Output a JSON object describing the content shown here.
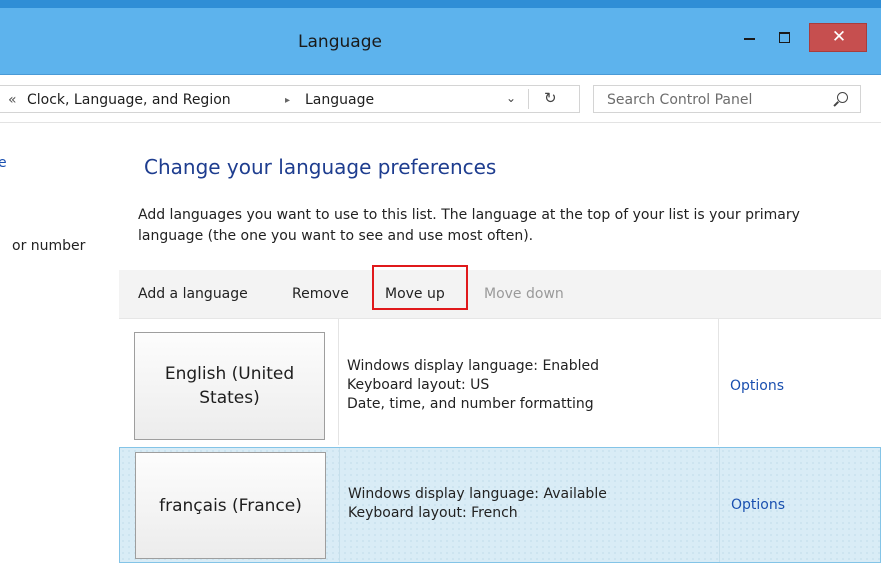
{
  "window": {
    "title": "Language",
    "close_glyph": "✕"
  },
  "address": {
    "back_glyph": "«",
    "breadcrumb": [
      "Clock, Language, and Region",
      "Language"
    ],
    "separator_glyph": "▸",
    "dropdown_glyph": "⌄",
    "refresh_glyph": "↻"
  },
  "search": {
    "placeholder": "Search Control Panel",
    "icon": "search-icon"
  },
  "left_nav": {
    "items": [
      "e",
      "or number"
    ]
  },
  "main": {
    "heading": "Change your language preferences",
    "description": "Add languages you want to use to this list. The language at the top of your list is your primary language (the one you want to see and use most often)."
  },
  "toolbar": {
    "add": "Add a language",
    "remove": "Remove",
    "move_up": "Move up",
    "move_down": "Move down",
    "highlighted": "Move up",
    "highlight_color": "#e0191b"
  },
  "languages": [
    {
      "name": "English (United States)",
      "details": [
        "Windows display language: Enabled",
        "Keyboard layout: US",
        "Date, time, and number formatting"
      ],
      "options": "Options"
    },
    {
      "name": "français (France)",
      "details": [
        "Windows display language: Available",
        "Keyboard layout: French"
      ],
      "options": "Options",
      "selected": true
    }
  ],
  "colors": {
    "titlebar": "#5db3ed",
    "close_button": "#c64f4f",
    "heading": "#1e3d8f",
    "link": "#1a50b0",
    "selected_row": "#d9ecf6"
  }
}
